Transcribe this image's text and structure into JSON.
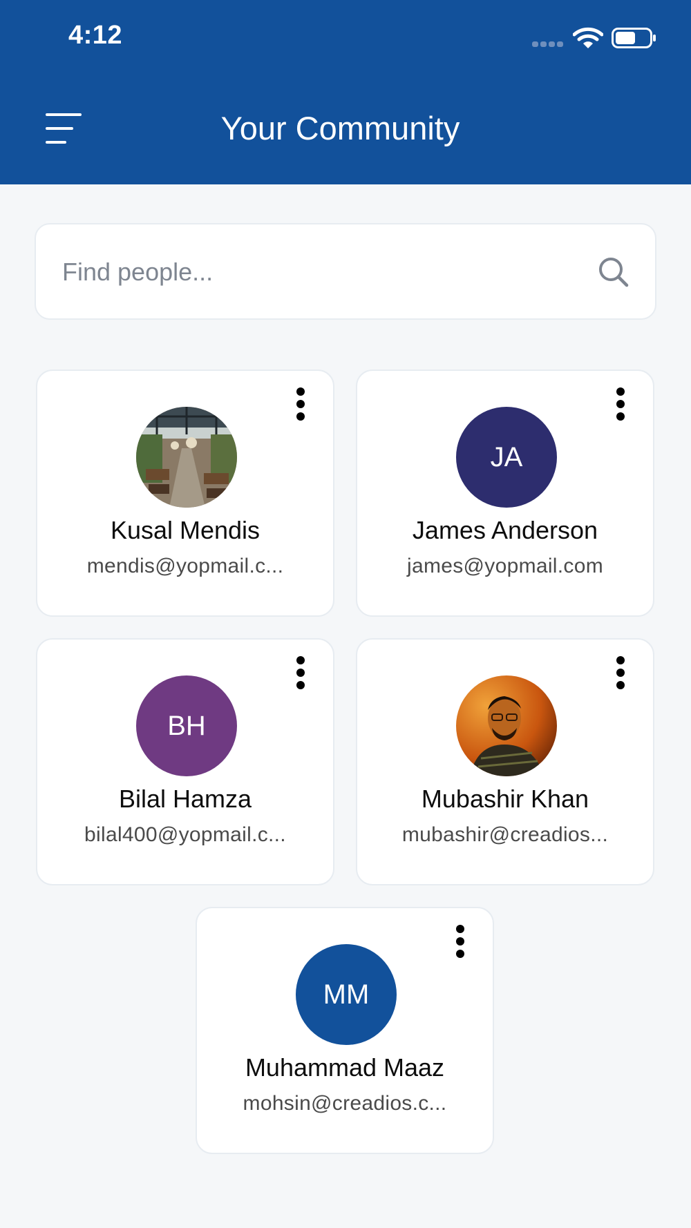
{
  "status_bar": {
    "time": "4:12"
  },
  "header": {
    "title": "Your Community",
    "menu_icon": "hamburger-menu-icon",
    "color": "#12519b"
  },
  "search": {
    "placeholder": "Find people...",
    "value": "",
    "icon": "search-icon"
  },
  "people": [
    {
      "name": "Kusal Mendis",
      "email": "mendis@yopmail.c...",
      "avatar": "photo",
      "initials": ""
    },
    {
      "name": "James Anderson",
      "email": "james@yopmail.com",
      "avatar": "initials",
      "initials": "JA",
      "color": "#2d2d6e"
    },
    {
      "name": "Bilal Hamza",
      "email": "bilal400@yopmail.c...",
      "avatar": "initials",
      "initials": "BH",
      "color": "#6f3a82"
    },
    {
      "name": "Mubashir Khan",
      "email": "mubashir@creadios...",
      "avatar": "photo",
      "initials": ""
    },
    {
      "name": "Muhammad Maaz",
      "email": "mohsin@creadios.c...",
      "avatar": "initials",
      "initials": "MM",
      "color": "#12519b"
    }
  ]
}
